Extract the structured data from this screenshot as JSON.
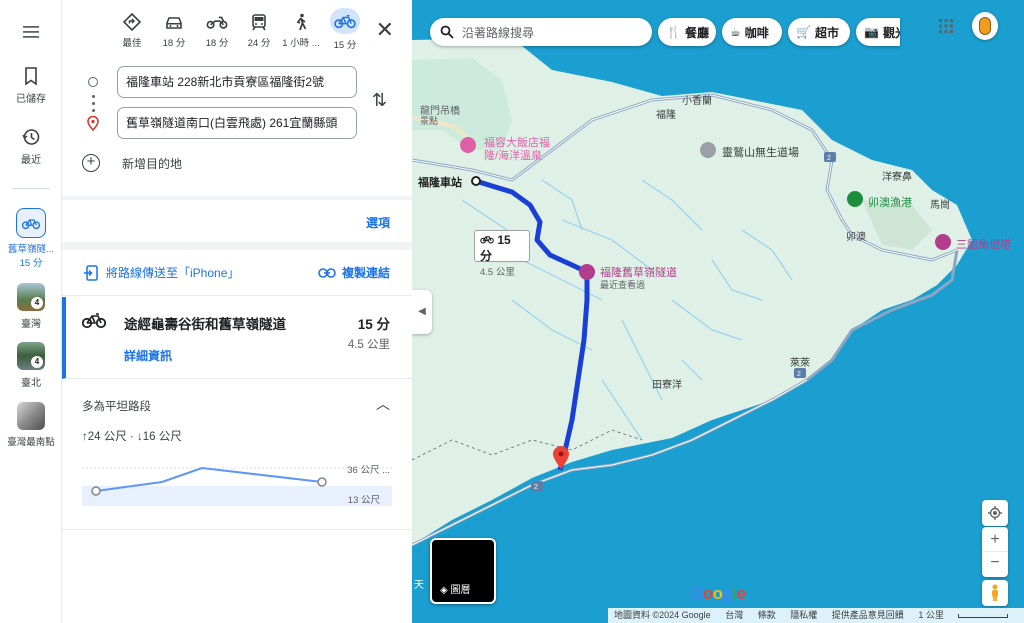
{
  "rail": {
    "saved_label": "已儲存",
    "recent_label": "最近",
    "active_label_1": "舊草嶺隧...",
    "active_label_2": "15 分",
    "taiwan_label": "臺灣",
    "taiwan_badge": "4",
    "taipei_label": "臺北",
    "taipei_badge": "4",
    "south_label": "臺灣最南點"
  },
  "modes": [
    {
      "label": "最佳",
      "icon": "directions-icon"
    },
    {
      "label": "18 分",
      "icon": "car-icon"
    },
    {
      "label": "18 分",
      "icon": "motorcycle-icon"
    },
    {
      "label": "24 分",
      "icon": "transit-icon"
    },
    {
      "label": "1 小時 ...",
      "icon": "walk-icon"
    },
    {
      "label": "15 分",
      "icon": "bicycle-icon"
    }
  ],
  "route": {
    "origin": "福隆車站 228新北市貢寮區福隆街2號",
    "destination": "舊草嶺隧道南口(白雲飛處) 261宜蘭縣頭",
    "add_destination": "新增目的地"
  },
  "options_label": "選項",
  "share": {
    "send_label": "將路線傳送至「iPhone」",
    "copy_label": "複製連結"
  },
  "route_card": {
    "title": "途經龜壽谷街和舊草嶺隧道",
    "time": "15 分",
    "distance": "4.5 公里",
    "details": "詳細資訊"
  },
  "elevation": {
    "title": "多為平坦路段",
    "stats": "↑24 公尺 · ↓16 公尺",
    "max_label": "36 公尺 ...",
    "min_label": "13 公尺"
  },
  "map": {
    "search_placeholder": "沿著路線搜尋",
    "chips": [
      {
        "label": "餐廳"
      },
      {
        "label": "咖啡"
      },
      {
        "label": "超市"
      },
      {
        "label": "觀光"
      }
    ],
    "labels": {
      "fulong_station": "福隆車站",
      "longmen": "龍門吊橋",
      "longmen2": "景點",
      "fulong": "福隆",
      "xiaoxiangLan": "小香蘭",
      "lingjiu": "靈鷲山無生道場",
      "yangliao": "洋寮鼻",
      "maogang": "卯澳漁港",
      "maoao": "卯澳",
      "magang": "馬崗",
      "sandiao": "三貂角燈塔",
      "tunnel": "福隆舊草嶺隧道",
      "tunnel_sub": "最近查看過",
      "hotel1": "福容大飯店福",
      "hotel2": "隆/海洋溫泉",
      "tianliaoyang": "田寮洋",
      "lailai": "萊萊",
      "tian": "天"
    },
    "time_bubble": {
      "time": "15 分",
      "distance": "4.5 公里"
    },
    "layers_label": "圖層",
    "google": "Google",
    "attribution": [
      "地圖資料 ©2024 Google",
      "台灣",
      "條款",
      "隱私權",
      "提供產品意見回饋",
      "1 公里"
    ]
  },
  "colors": {
    "accent": "#1a73e8",
    "route": "#1a3fd6",
    "land": "#dff1e7",
    "water": "#1b9fd0",
    "road": "#8ba6c4",
    "poi": "#b43c8c"
  }
}
